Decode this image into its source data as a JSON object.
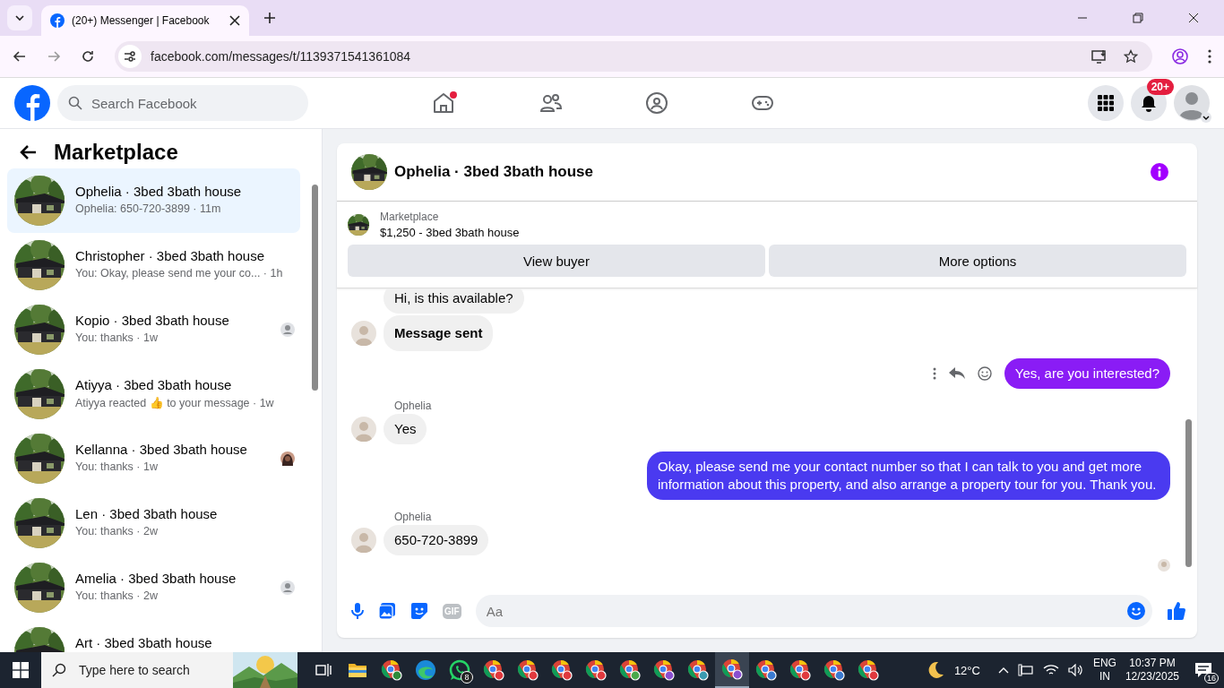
{
  "browser": {
    "tab_title": "(20+) Messenger | Facebook",
    "url": "facebook.com/messages/t/1139371541361084"
  },
  "header": {
    "search_placeholder": "Search Facebook",
    "notification_badge": "20+"
  },
  "sidebar": {
    "title": "Marketplace",
    "conversations": [
      {
        "name": "Ophelia · 3bed 3bath house",
        "preview": "Ophelia: 650-720-3899 · 11m",
        "selected": true
      },
      {
        "name": "Christopher · 3bed 3bath house",
        "preview": "You: Okay, please send me your co...  · 1h",
        "selected": false
      },
      {
        "name": "Kopio · 3bed 3bath house",
        "preview": "You: thanks · 1w",
        "selected": false,
        "seen": true,
        "seen_photo": false
      },
      {
        "name": "Atiyya · 3bed 3bath house",
        "preview": "Atiyya reacted 👍 to your message · 1w",
        "selected": false
      },
      {
        "name": "Kellanna · 3bed 3bath house",
        "preview": "You: thanks · 1w",
        "selected": false,
        "seen": true,
        "seen_photo": true
      },
      {
        "name": "Len · 3bed 3bath house",
        "preview": "You: thanks · 2w",
        "selected": false
      },
      {
        "name": "Amelia · 3bed 3bath house",
        "preview": "You: thanks · 2w",
        "selected": false,
        "seen": true,
        "seen_photo": false
      },
      {
        "name": "Art · 3bed 3bath house",
        "selected": false
      }
    ]
  },
  "chat": {
    "title": "Ophelia · 3bed 3bath house",
    "listing_label": "Marketplace",
    "listing": "$1,250 - 3bed 3bath house",
    "buttons": [
      "View buyer",
      "More options"
    ],
    "messages": [
      {
        "kind": "incoming",
        "text": "Hi, is this available?",
        "avatar": false
      },
      {
        "kind": "notice",
        "text": "Message sent",
        "avatar": true
      },
      {
        "kind": "outgoing",
        "text": "Yes, are you interested?",
        "color": "#8a1cf5",
        "hover_actions": true
      },
      {
        "kind": "incoming",
        "sender": "Ophelia",
        "text": "Yes",
        "avatar": true
      },
      {
        "kind": "outgoing",
        "text": "Okay, please send me your contact number so that I can talk to you and get more information about this property, and also arrange a property tour for you. Thank you.",
        "color": "#4a3af0"
      },
      {
        "kind": "incoming",
        "sender": "Ophelia",
        "text": "650-720-3899",
        "avatar": true
      }
    ],
    "composer": {
      "placeholder": "Aa",
      "gif_label": "GIF"
    }
  },
  "taskbar": {
    "search_placeholder": "Type here to search",
    "apps": [
      {
        "kind": "taskview"
      },
      {
        "kind": "explorer"
      },
      {
        "kind": "chrome",
        "color": "#2e8b3a"
      },
      {
        "kind": "edge"
      },
      {
        "kind": "whatsapp",
        "badge": "8"
      },
      {
        "kind": "chrome",
        "color": "#e0393e"
      },
      {
        "kind": "chrome",
        "color": "#e0393e"
      },
      {
        "kind": "chrome",
        "color": "#e0393e"
      },
      {
        "kind": "chrome",
        "color": "#e0393e"
      },
      {
        "kind": "chrome",
        "color": "#4aa84a"
      },
      {
        "kind": "chrome",
        "color": "#8a4fd0"
      },
      {
        "kind": "chrome",
        "color": "#3a9ab0"
      },
      {
        "kind": "chrome",
        "color": "#8a4fd0",
        "active": true
      },
      {
        "kind": "chrome",
        "color": "#3a7ad0"
      },
      {
        "kind": "chrome",
        "color": "#e0393e"
      },
      {
        "kind": "chrome",
        "color": "#3a7ad0"
      },
      {
        "kind": "chrome",
        "color": "#e0393e"
      }
    ],
    "weather": "12°C",
    "lang": "ENG",
    "region": "IN",
    "time": "10:37 PM",
    "date": "12/23/2025",
    "notifications": "16"
  }
}
